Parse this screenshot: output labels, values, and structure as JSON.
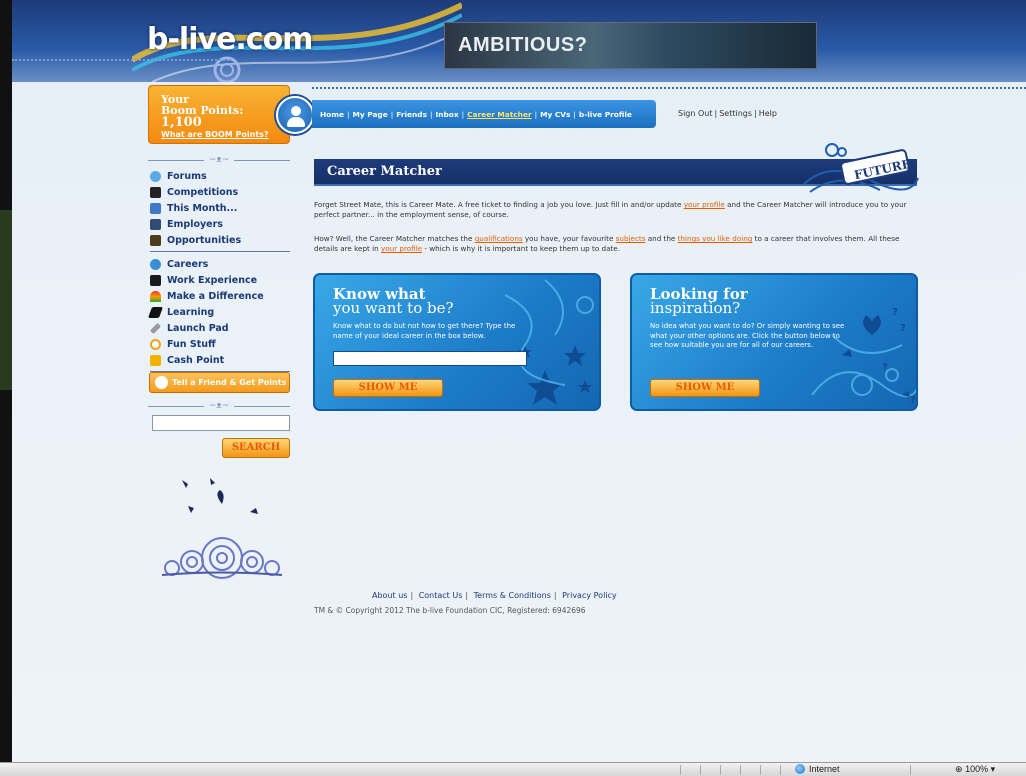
{
  "header": {
    "logo": "b-live.com",
    "ad_text": "AMBITIOUS?"
  },
  "boom": {
    "line1": "Your",
    "line2": "Boom Points:",
    "points": "1,100",
    "link": "What are BOOM Points?"
  },
  "nav": {
    "items": [
      {
        "label": "Home"
      },
      {
        "label": "My Page"
      },
      {
        "label": "Friends"
      },
      {
        "label": "Inbox"
      },
      {
        "label": "Career Matcher"
      },
      {
        "label": "My CVs"
      },
      {
        "label": "b-live Profile"
      }
    ],
    "sep": "|"
  },
  "account": {
    "sign_out": "Sign Out",
    "settings": "Settings",
    "help": "Help",
    "sep": "|"
  },
  "sidebar": {
    "group1": [
      {
        "label": "Forums",
        "icon": "forums-icon",
        "color": "#5aa9e6"
      },
      {
        "label": "Competitions",
        "icon": "competitions-icon",
        "color": "#222222"
      },
      {
        "label": "This Month...",
        "icon": "calendar-icon",
        "color": "#3d79c4"
      },
      {
        "label": "Employers",
        "icon": "employers-icon",
        "color": "#334a77"
      },
      {
        "label": "Opportunities",
        "icon": "opportunities-icon",
        "color": "#4d3a1a"
      }
    ],
    "group2": [
      {
        "label": "Careers",
        "icon": "careers-icon",
        "color": "#3a8ed4"
      },
      {
        "label": "Work Experience",
        "icon": "briefcase-icon",
        "color": "#1a1a1a"
      },
      {
        "label": "Make a Difference",
        "icon": "rainbow-icon",
        "color": "#4c7a3a"
      },
      {
        "label": "Learning",
        "icon": "mortarboard-icon",
        "color": "#111111"
      },
      {
        "label": "Launch Pad",
        "icon": "rocket-icon",
        "color": "#7a7a7a"
      },
      {
        "label": "Fun Stuff",
        "icon": "smiley-icon",
        "color": "#f0a020"
      },
      {
        "label": "Cash Point",
        "icon": "cash-icon",
        "color": "#f2b300"
      }
    ],
    "tell_friend": "Tell a Friend & Get Points",
    "search_button": "SEARCH",
    "search_placeholder": ""
  },
  "main": {
    "title": "Career Matcher",
    "badge": "FUTURE",
    "para1": {
      "pre": "Forget Street Mate, this is Career Mate. A free ticket to finding a job you love. Just fill in and/or update ",
      "link": "your profile",
      "post": " and the Career Matcher will introduce you to your perfect partner... in the employment sense, of course."
    },
    "para2": {
      "t1": "How? Well, the Career Matcher matches the ",
      "l1": "qualifications",
      "t2": " you have, your favourite ",
      "l2": "subjects",
      "t3": " and the ",
      "l3": "things you like doing",
      "t4": " to a career that involves them. All these details are kept in ",
      "l4": "your profile",
      "t5": " - which is why it is important to keep them up to date."
    },
    "card1": {
      "title1": "Know what",
      "title2": "you want to be?",
      "desc": "Know what to do but not how to get there? Type the name of your ideal career in the box below.",
      "input_value": "",
      "button": "SHOW ME"
    },
    "card2": {
      "title1": "Looking for",
      "title2": "inspiration?",
      "desc": "No idea what you want to do? Or simply wanting to see what your other options are. Click the button below to see how suitable you are for all of our careers.",
      "button": "SHOW ME"
    }
  },
  "footer": {
    "links": [
      "About us",
      "Contact Us",
      "Terms & Conditions",
      "Privacy Policy"
    ],
    "sep": "|",
    "copyright": "TM & © Copyright 2012 The b-live Foundation CIC, Registered: 6942696"
  },
  "statusbar": {
    "zone": "Internet",
    "zoom": "100%"
  },
  "colors": {
    "accent": "#1c6fbe",
    "brand_orange": "#f38a10",
    "link_orange": "#e85c00",
    "navy": "#1d3c7b"
  }
}
